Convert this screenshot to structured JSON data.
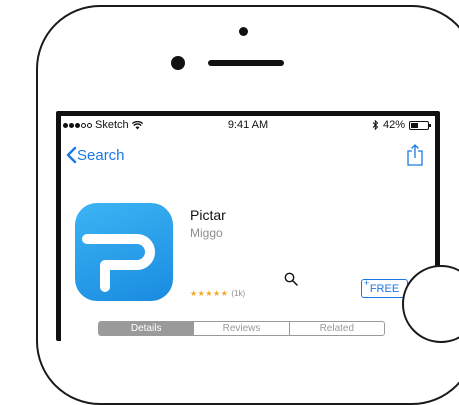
{
  "status_bar": {
    "carrier": "Sketch",
    "time": "9:41 AM",
    "battery": "42%",
    "battery_level": 0.42
  },
  "nav": {
    "back_label": "Search"
  },
  "app": {
    "title": "Pictar",
    "developer": "Miggo",
    "stars": "★★★★★",
    "rating_count": "(1k)",
    "get_label": "FREE",
    "plus": "+"
  },
  "tabs": [
    {
      "label": "Details",
      "active": true
    },
    {
      "label": "Reviews",
      "active": false
    },
    {
      "label": "Related",
      "active": false
    }
  ],
  "colors": {
    "accent": "#1a78e6",
    "icon_gradient_start": "#3cb4f4",
    "icon_gradient_end": "#1a8be0",
    "star": "#f5a623"
  }
}
